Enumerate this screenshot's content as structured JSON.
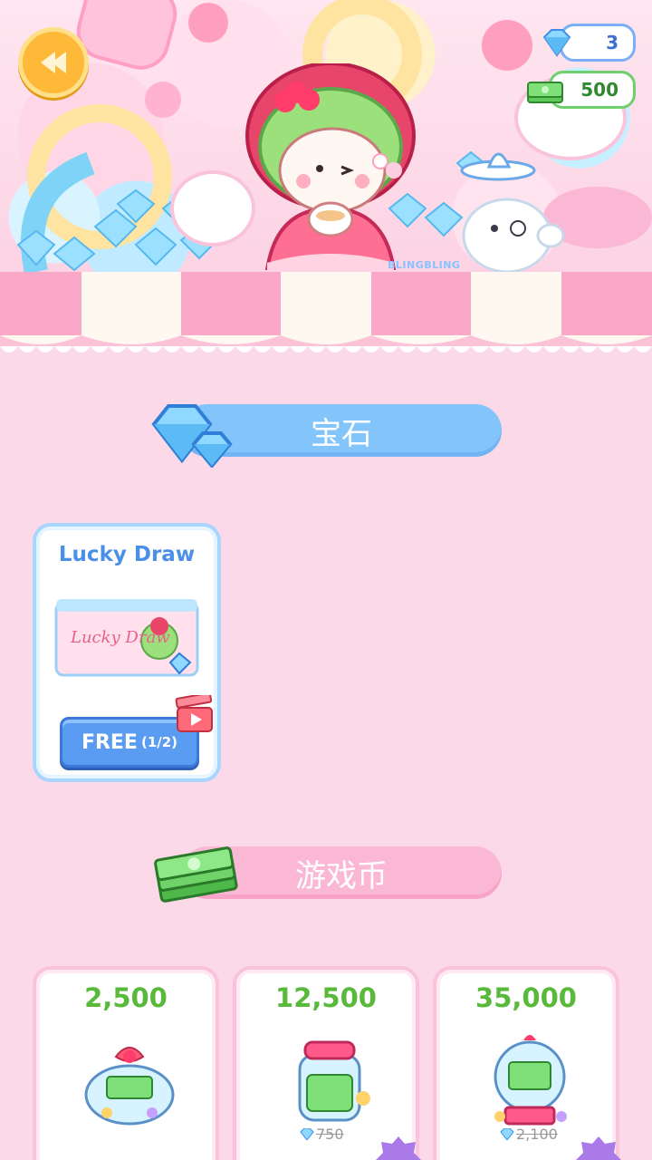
{
  "header": {
    "back_icon": "back-arrow-icon",
    "gems": {
      "icon": "gem-icon",
      "value": "3"
    },
    "money": {
      "icon": "cash-icon",
      "value": "500"
    },
    "sign_text": "BLINGBLING"
  },
  "sections": {
    "gems": {
      "title": "宝石",
      "icon": "gem-stack-icon",
      "color": "#83c5fa"
    },
    "coins": {
      "title": "游戏币",
      "icon": "cash-stack-icon",
      "color": "#fbb8d4"
    }
  },
  "lucky_draw": {
    "title": "Lucky Draw",
    "ticket_text": "Lucky Draw",
    "button_label": "FREE",
    "button_count": "(1/2)",
    "video_icon": "video-ad-icon"
  },
  "coin_packs": [
    {
      "amount": "2,500",
      "art": "money-bag-icon",
      "old_price": ""
    },
    {
      "amount": "12,500",
      "art": "money-jar-icon",
      "old_price": "750"
    },
    {
      "amount": "35,000",
      "art": "money-gumball-icon",
      "old_price": "2,100"
    }
  ],
  "colors": {
    "background": "#fbd9e8",
    "coin_green": "#58b93a",
    "lucky_blue": "#4a8fe8",
    "free_button": "#5a9cf2"
  }
}
